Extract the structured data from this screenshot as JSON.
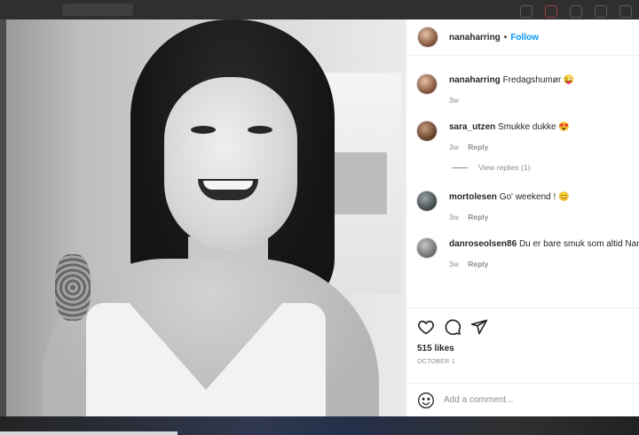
{
  "post": {
    "username": "nanaharring",
    "follow_label": "Follow",
    "caption_username": "nanaharring",
    "caption_text": "Fredagshumør 😜",
    "caption_time": "3w"
  },
  "comments": [
    {
      "username": "sara_utzen",
      "text": "Smukke dukke 😍",
      "time": "3w",
      "reply": "Reply"
    },
    {
      "username": "mortolesen",
      "text": "Go' weekend ! 😊",
      "time": "3w",
      "reply": "Reply"
    },
    {
      "username": "danroseolsen86",
      "text": "Du er bare smuk som altid Nana",
      "time": "3w",
      "reply": "Reply"
    }
  ],
  "view_replies": "View replies (1)",
  "likes": "515 likes",
  "date": "OCTOBER 1",
  "add_comment": {
    "placeholder": "Add a comment..."
  },
  "icons": [
    "heart-icon",
    "comment-icon",
    "share-icon",
    "emoji-icon"
  ],
  "colors": {
    "accent": "#0095f6",
    "text": "#262626",
    "muted": "#8e8e8e"
  }
}
